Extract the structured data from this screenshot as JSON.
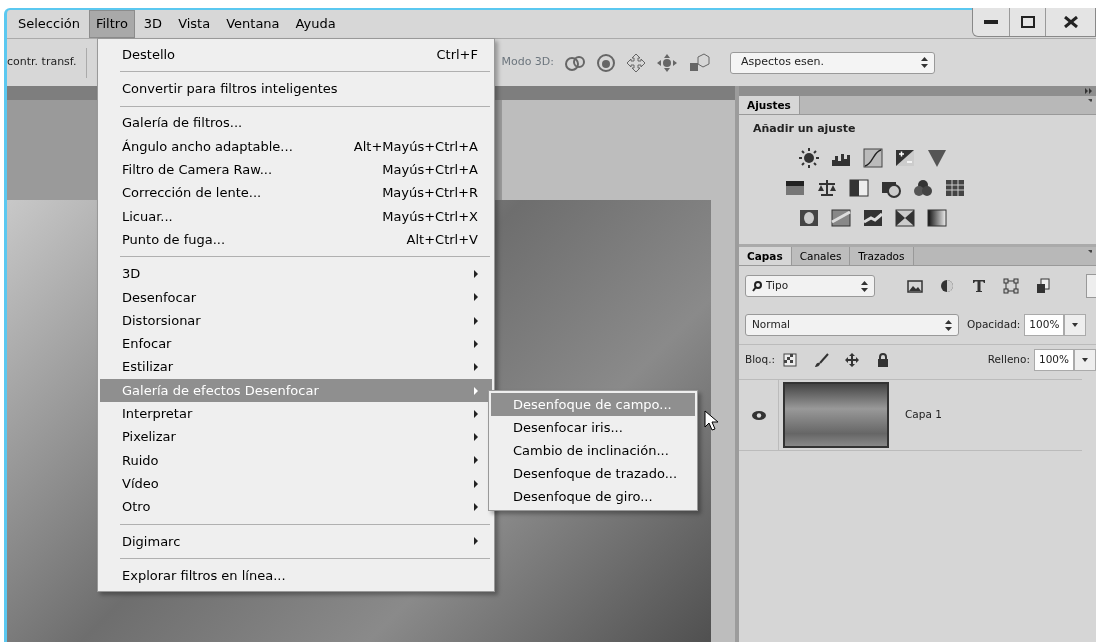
{
  "menu_bar": [
    {
      "label": "Selección",
      "selected": false
    },
    {
      "label": "Filtro",
      "selected": true
    },
    {
      "label": "3D",
      "selected": false
    },
    {
      "label": "Vista",
      "selected": false
    },
    {
      "label": "Ventana",
      "selected": false
    },
    {
      "label": "Ayuda",
      "selected": false
    }
  ],
  "toolbar": {
    "option_label": "contr. transf.",
    "mode_label": "Modo 3D:",
    "workspace": "Aspectos esen."
  },
  "filter_menu": [
    {
      "kind": "item",
      "label": "Destello",
      "shortcut": "Ctrl+F",
      "selected": false
    },
    {
      "kind": "separator"
    },
    {
      "kind": "item",
      "label": "Convertir para filtros inteligentes",
      "selected": false
    },
    {
      "kind": "separator"
    },
    {
      "kind": "item",
      "label": "Galería de filtros...",
      "selected": false
    },
    {
      "kind": "item",
      "label": "Ángulo ancho adaptable...",
      "shortcut": "Alt+Mayús+Ctrl+A",
      "selected": false
    },
    {
      "kind": "item",
      "label": "Filtro de Camera Raw...",
      "shortcut": "Mayús+Ctrl+A",
      "selected": false
    },
    {
      "kind": "item",
      "label": "Corrección de lente...",
      "shortcut": "Mayús+Ctrl+R",
      "selected": false
    },
    {
      "kind": "item",
      "label": "Licuar...",
      "shortcut": "Mayús+Ctrl+X",
      "selected": false
    },
    {
      "kind": "item",
      "label": "Punto de fuga...",
      "shortcut": "Alt+Ctrl+V",
      "selected": false
    },
    {
      "kind": "separator"
    },
    {
      "kind": "submenu",
      "label": "3D",
      "selected": false
    },
    {
      "kind": "submenu",
      "label": "Desenfocar",
      "selected": false
    },
    {
      "kind": "submenu",
      "label": "Distorsionar",
      "selected": false
    },
    {
      "kind": "submenu",
      "label": "Enfocar",
      "selected": false
    },
    {
      "kind": "submenu",
      "label": "Estilizar",
      "selected": false
    },
    {
      "kind": "submenu",
      "label": "Galería de efectos Desenfocar",
      "selected": true
    },
    {
      "kind": "submenu",
      "label": "Interpretar",
      "selected": false
    },
    {
      "kind": "submenu",
      "label": "Pixelizar",
      "selected": false
    },
    {
      "kind": "submenu",
      "label": "Ruido",
      "selected": false
    },
    {
      "kind": "submenu",
      "label": "Vídeo",
      "selected": false
    },
    {
      "kind": "submenu",
      "label": "Otro",
      "selected": false
    },
    {
      "kind": "separator"
    },
    {
      "kind": "submenu",
      "label": "Digimarc",
      "selected": false
    },
    {
      "kind": "separator"
    },
    {
      "kind": "item",
      "label": "Explorar filtros en línea...",
      "selected": false
    }
  ],
  "submenu": [
    {
      "label": "Desenfoque de campo...",
      "selected": true
    },
    {
      "label": "Desenfocar iris...",
      "selected": false
    },
    {
      "label": "Cambio de inclinación...",
      "selected": false
    },
    {
      "label": "Desenfoque de trazado...",
      "selected": false
    },
    {
      "label": "Desenfoque de giro...",
      "selected": false
    }
  ],
  "adjustments_panel": {
    "tabs": [
      {
        "label": "Ajustes",
        "selected": true
      }
    ],
    "heading": "Añadir un ajuste"
  },
  "layers_panel": {
    "tabs": [
      {
        "label": "Capas",
        "selected": true
      },
      {
        "label": "Canales",
        "selected": false
      },
      {
        "label": "Trazados",
        "selected": false
      }
    ],
    "filter": "Tipo",
    "blend_mode": "Normal",
    "opacity_label": "Opacidad:",
    "opacity": "100%",
    "lock_label": "Bloq.:",
    "fill_label": "Relleno:",
    "fill": "100%",
    "layers": [
      {
        "name": "Capa 1",
        "visible": true
      }
    ]
  }
}
